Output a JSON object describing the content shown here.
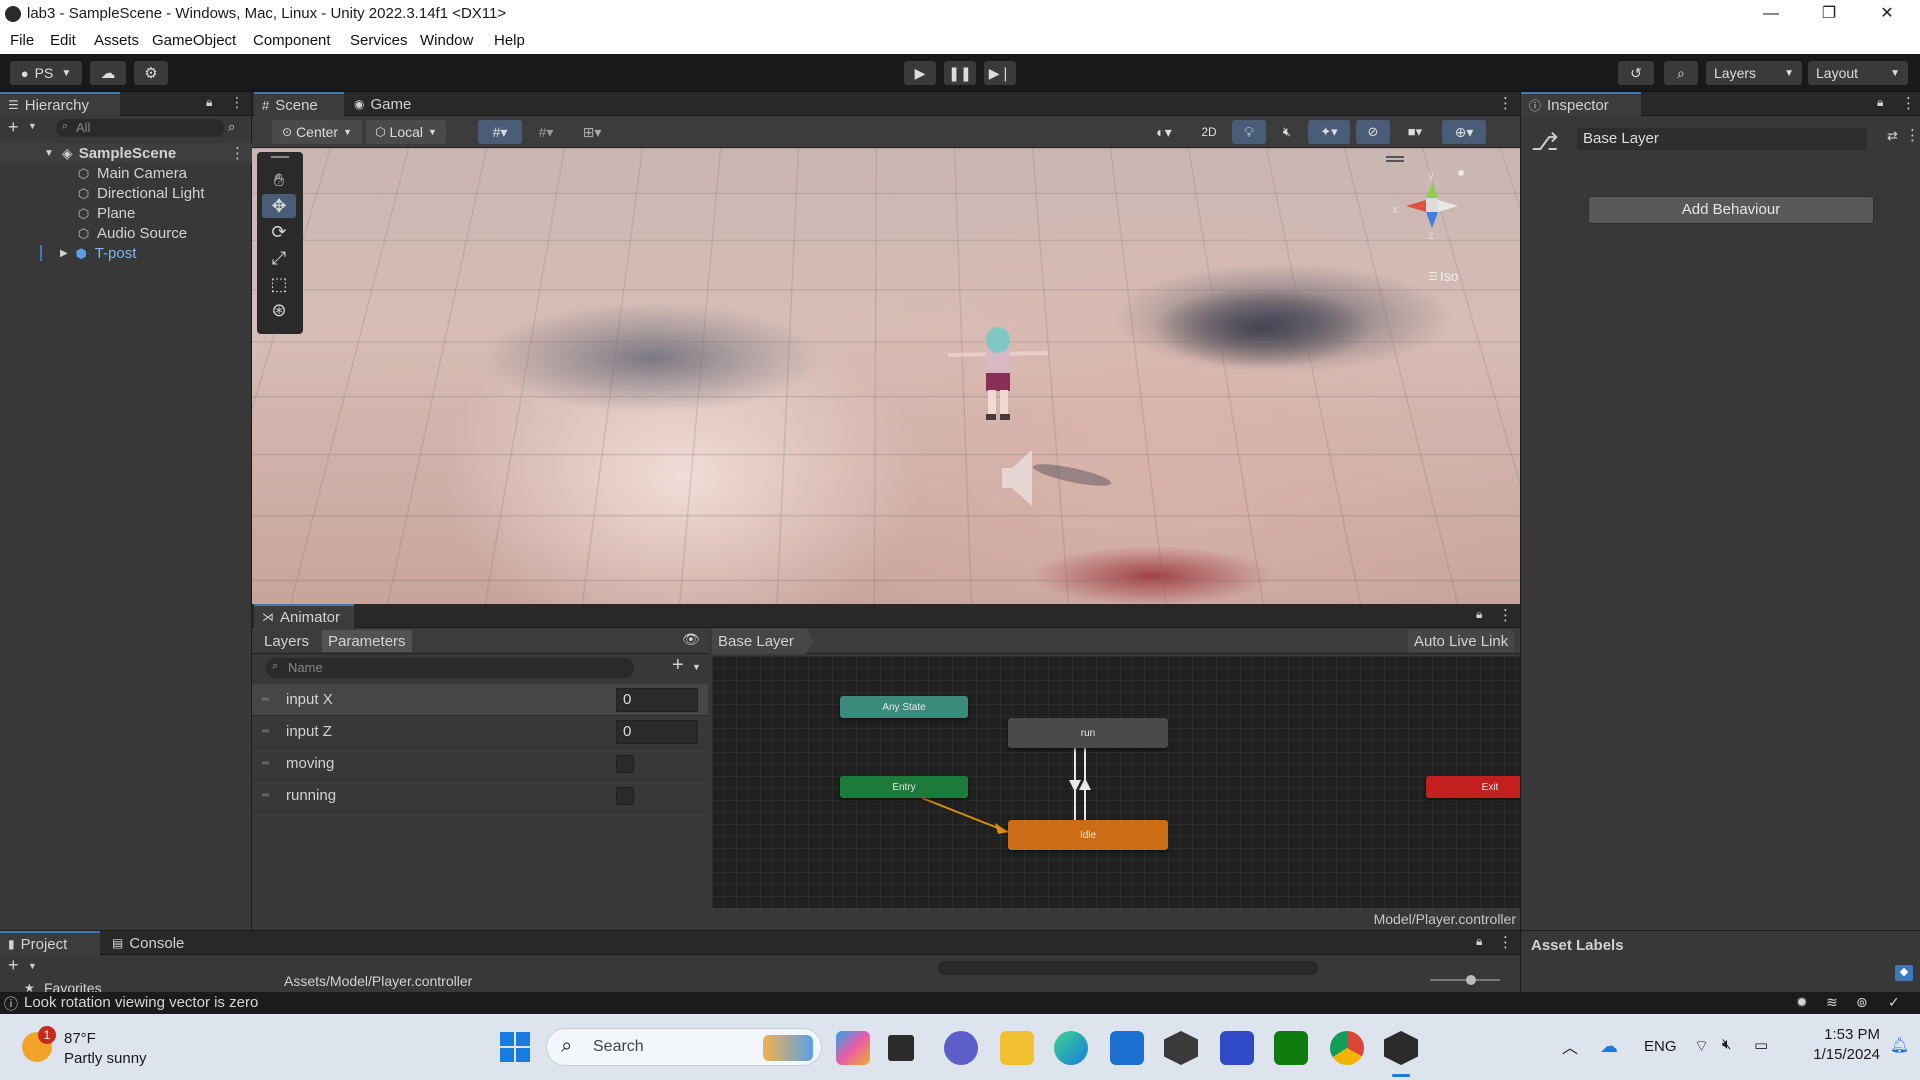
{
  "window": {
    "title": "lab3 - SampleScene - Windows, Mac, Linux - Unity 2022.3.14f1 <DX11>",
    "minimize": "—",
    "restore": "❐",
    "close": "✕"
  },
  "menu": {
    "items": [
      "File",
      "Edit",
      "Assets",
      "GameObject",
      "Component",
      "Services",
      "Window",
      "Help"
    ]
  },
  "toolbar": {
    "account": "PS",
    "layers": "Layers",
    "layout": "Layout"
  },
  "hierarchy": {
    "tab": "Hierarchy",
    "search_placeholder": "All",
    "scene": "SampleScene",
    "objects": [
      "Main Camera",
      "Directional Light",
      "Plane",
      "Audio Source",
      "T-post"
    ]
  },
  "scene": {
    "tab_scene": "Scene",
    "tab_game": "Game",
    "pivot": "Center",
    "space": "Local",
    "toggle_2d": "2D",
    "projection": "Iso",
    "axis_x": "x",
    "axis_y": "y",
    "axis_z": "z"
  },
  "inspector": {
    "tab": "Inspector",
    "name": "Base Layer",
    "add_behaviour": "Add Behaviour"
  },
  "animator": {
    "tab": "Animator",
    "tab_layers": "Layers",
    "tab_parameters": "Parameters",
    "search_placeholder": "Name",
    "breadcrumb": "Base Layer",
    "auto_live_link": "Auto Live Link",
    "parameters": [
      {
        "name": "input X",
        "value": "0"
      },
      {
        "name": "input Z",
        "value": "0"
      },
      {
        "name": "moving",
        "value": false
      },
      {
        "name": "running",
        "value": false
      }
    ],
    "states": {
      "any_state": "Any State",
      "run": "run",
      "entry": "Entry",
      "exit": "Exit",
      "idle": "Idle"
    },
    "colors": {
      "any_state": "#3b8b7c",
      "entry": "#1c7a3a",
      "exit": "#c41f1f",
      "idle": "#cb6d14",
      "run": "#4a4a4a"
    },
    "controller_path": "Model/Player.controller"
  },
  "project": {
    "tab_project": "Project",
    "tab_console": "Console",
    "path": "Assets/Model/Player.controller",
    "favorites": "Favorites",
    "asset_labels": "Asset Labels"
  },
  "status": {
    "message": "Look rotation viewing vector is zero"
  },
  "taskbar": {
    "weather_temp": "87°F",
    "weather_desc": "Partly sunny",
    "weather_badge": "1",
    "search": "Search",
    "lang": "ENG",
    "time": "1:53 PM",
    "date": "1/15/2024"
  }
}
